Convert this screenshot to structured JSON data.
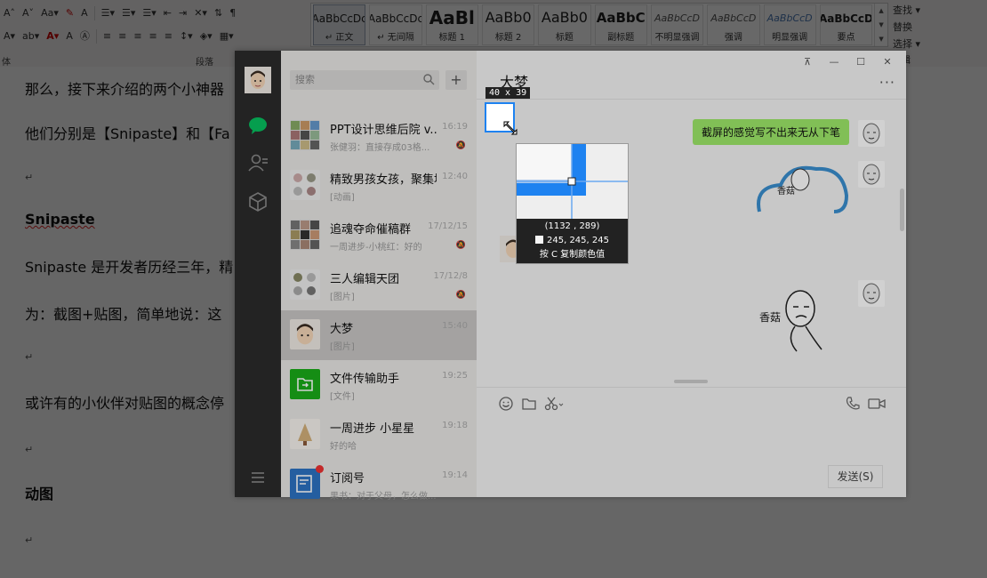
{
  "ribbon": {
    "row1": [
      "A˄",
      "A˅",
      "Aa▾",
      "✎",
      "A",
      "☰▾",
      "☰▾",
      "☰▾",
      "⇤",
      "⇥",
      "✕▾",
      "⇅",
      "¶"
    ],
    "row2": [
      "A▾",
      "ab▾",
      "A▾",
      "A",
      "Ⓐ",
      "≡",
      "≡",
      "≡",
      "≡",
      "≡",
      "↕▾",
      "◈▾",
      "▦▾"
    ],
    "group_font_label": "体",
    "group_para_label": "段落",
    "styles": [
      {
        "preview": "AaBbCcDc",
        "name": "↵ 正文",
        "variant": "normal",
        "active": true
      },
      {
        "preview": "AaBbCcDc",
        "name": "↵ 无间隔",
        "variant": "normal",
        "active": false
      },
      {
        "preview": "AaBl",
        "name": "标题 1",
        "variant": "big",
        "active": false
      },
      {
        "preview": "AaBb0",
        "name": "标题 2",
        "variant": "mid",
        "active": false
      },
      {
        "preview": "AaBb0",
        "name": "标题",
        "variant": "mid",
        "active": false
      },
      {
        "preview": "AaBbC",
        "name": "副标题",
        "variant": "mid-b",
        "active": false
      },
      {
        "preview": "AaBbCcD",
        "name": "不明显强调",
        "variant": "it",
        "active": false
      },
      {
        "preview": "AaBbCcD",
        "name": "强调",
        "variant": "it",
        "active": false
      },
      {
        "preview": "AaBbCcD",
        "name": "明显强调",
        "variant": "it-blue",
        "active": false
      },
      {
        "preview": "AaBbCcD",
        "name": "要点",
        "variant": "bold",
        "active": false
      }
    ],
    "edit": {
      "find": "查找 ▾",
      "replace": "替换",
      "select": "选择 ▾",
      "group_label": "编辑"
    }
  },
  "document": {
    "lines": [
      {
        "text": "那么，接下来介绍的两个小神器",
        "kind": "normal"
      },
      {
        "text": "他们分别是【Snipaste】和【Fa",
        "kind": "normal"
      },
      {
        "text": "Snipaste",
        "kind": "heading"
      },
      {
        "text": "Snipaste 是开发者历经三年，精",
        "kind": "normal"
      },
      {
        "text": "为：截图+贴图，简单地说：这",
        "kind": "normal"
      },
      {
        "text": "或许有的小伙伴对贴图的概念停",
        "kind": "normal"
      },
      {
        "text": "动图",
        "kind": "heading"
      }
    ],
    "para_mark": "↵"
  },
  "wechat": {
    "search_placeholder": "搜索",
    "add_label": "+",
    "conversations": [
      {
        "name": "PPT设计思维后院 v...",
        "msg": "张健羽：直接存成03格...",
        "time": "16:19",
        "muted": true,
        "active": false,
        "avatar": "grid"
      },
      {
        "name": "精致男孩女孩，聚集地",
        "msg": "[动画]",
        "time": "12:40",
        "muted": false,
        "active": false,
        "avatar": "grid"
      },
      {
        "name": "追魂夺命催稿群",
        "msg": "一周进步-小桃红：好的",
        "time": "17/12/15",
        "muted": true,
        "active": false,
        "avatar": "grid"
      },
      {
        "name": "三人编辑天团",
        "msg": "[图片]",
        "time": "17/12/8",
        "muted": true,
        "active": false,
        "avatar": "grid"
      },
      {
        "name": "大梦",
        "msg": "[图片]",
        "time": "15:40",
        "muted": false,
        "active": true,
        "avatar": "face"
      },
      {
        "name": "文件传输助手",
        "msg": "[文件]",
        "time": "19:25",
        "muted": false,
        "active": false,
        "avatar": "file"
      },
      {
        "name": "一周进步 小星星",
        "msg": "好的哈",
        "time": "19:18",
        "muted": false,
        "active": false,
        "avatar": "tree"
      },
      {
        "name": "订阅号",
        "msg": "果书：对于父母，怎么做...",
        "time": "19:14",
        "muted": false,
        "active": false,
        "avatar": "sub"
      }
    ],
    "chat_title": "大梦",
    "window_controls": [
      "⊼",
      "—",
      "☐",
      "✕"
    ],
    "more": "···",
    "my_message": "截屏的感觉写不出来无从下笔",
    "sticker_text_1": "香菇",
    "sticker_text_2": "香菇",
    "send_label": "发送(S)"
  },
  "snipaste": {
    "size": "40 x 39",
    "coords": "(1132 , 289)",
    "rgb": "245, 245, 245",
    "hint": "按 C 复制颜色值"
  },
  "colors": {
    "accent": "#1e82f0",
    "wechat_green": "#9eea6a",
    "sidebar": "#2b2b2b"
  }
}
